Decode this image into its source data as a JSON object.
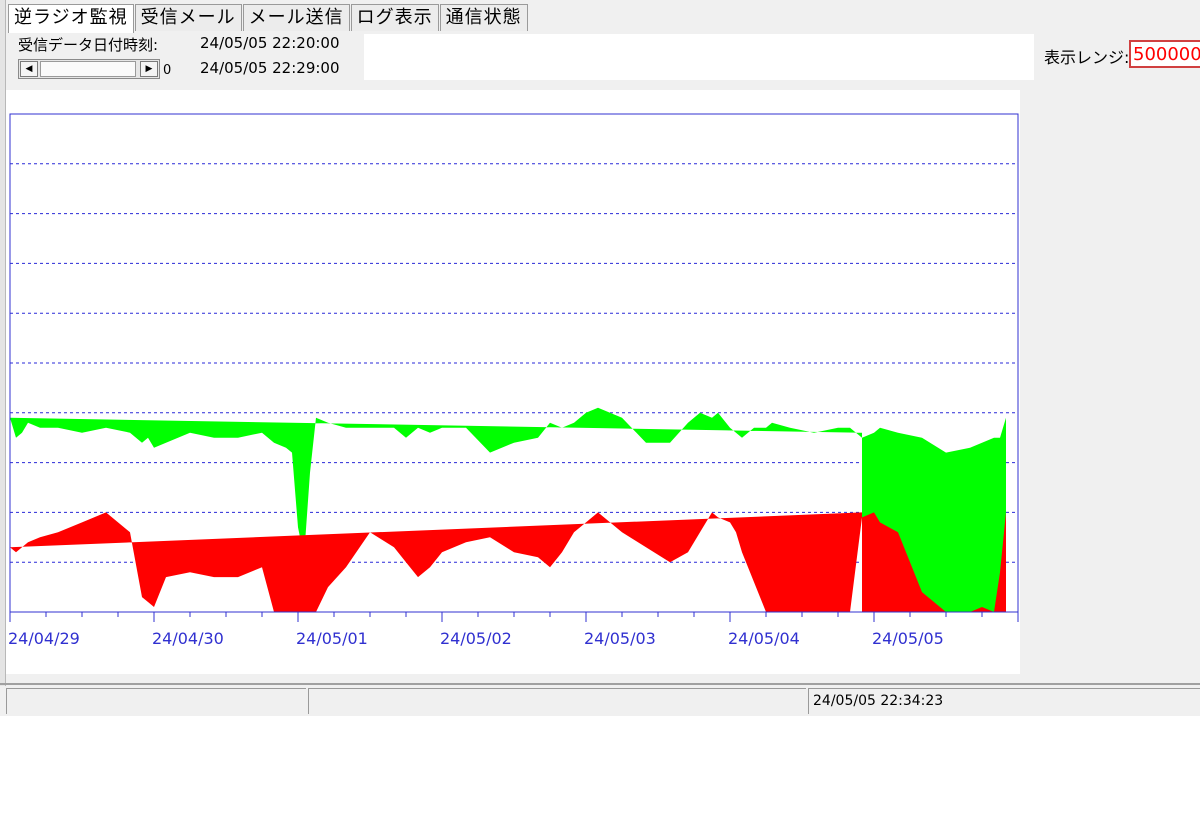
{
  "tabs": [
    {
      "label": "逆ラジオ監視",
      "active": true
    },
    {
      "label": "受信メール",
      "active": false
    },
    {
      "label": "メール送信",
      "active": false
    },
    {
      "label": "ログ表示",
      "active": false
    },
    {
      "label": "通信状態",
      "active": false
    }
  ],
  "header": {
    "recv_label": "受信データ日付時刻:",
    "recv_time_1": "24/05/05 22:20:00",
    "recv_time_2": "24/05/05 22:29:00",
    "scroll_value": "0",
    "range_label": "表示レンジ:",
    "range_value": "500000"
  },
  "colors": {
    "series_total": "#00ff00",
    "series_base": "#ff0000",
    "axis": "#3030d0",
    "grid": "#2a2ad8",
    "range_text": "#ff0000"
  },
  "chart_data": {
    "type": "area",
    "x": [
      "24/05/04 22:00",
      "24/04/29 00:00",
      "24/04/29 01:00",
      "24/04/29 02:00",
      "24/04/29 03:00",
      "24/04/29 05:00",
      "24/04/29 08:00",
      "24/04/29 12:00",
      "24/04/29 16:00",
      "24/04/29 20:00",
      "24/04/29 22:00",
      "24/04/29 23:00",
      "24/04/30 00:00",
      "24/04/30 02:00",
      "24/04/30 06:00",
      "24/04/30 10:00",
      "24/04/30 14:00",
      "24/04/30 18:00",
      "24/04/30 20:00",
      "24/04/30 22:00",
      "24/04/30 23:00",
      "24/05/01 00:00",
      "24/05/01 01:00",
      "24/05/01 02:00",
      "24/05/01 03:00",
      "24/05/01 05:00",
      "24/05/01 08:00",
      "24/05/01 12:00",
      "24/05/01 16:00",
      "24/05/01 18:00",
      "24/05/01 20:00",
      "24/05/01 22:00",
      "24/05/02 00:00",
      "24/05/02 04:00",
      "24/05/02 08:00",
      "24/05/02 12:00",
      "24/05/02 16:00",
      "24/05/02 18:00",
      "24/05/02 20:00",
      "24/05/02 22:00",
      "24/05/03 00:00",
      "24/05/03 02:00",
      "24/05/03 06:00",
      "24/05/03 10:00",
      "24/05/03 14:00",
      "24/05/03 17:00",
      "24/05/03 19:00",
      "24/05/03 21:00",
      "24/05/03 22:00",
      "24/05/04 00:00",
      "24/05/04 01:00",
      "24/05/04 02:00",
      "24/05/04 04:00",
      "24/05/04 06:00",
      "24/05/04 07:00",
      "24/05/04 10:00",
      "24/05/04 14:00",
      "24/05/04 18:00",
      "24/05/04 20:00",
      "24/05/04 22:00",
      "24/05/05 00:00",
      "24/05/05 01:00",
      "24/05/05 04:00",
      "24/05/05 08:00",
      "24/05/05 12:00",
      "24/05/05 16:00",
      "24/05/05 18:00",
      "24/05/05 20:00",
      "24/05/05 21:00",
      "24/05/05 22:00"
    ],
    "series": [
      {
        "values": [
          180000,
          195000,
          175000,
          180000,
          190000,
          185000,
          185000,
          180000,
          185000,
          180000,
          170000,
          175000,
          165000,
          170000,
          180000,
          175000,
          175000,
          180000,
          170000,
          165000,
          160000,
          85000,
          55000,
          140000,
          195000,
          190000,
          185000,
          185000,
          185000,
          175000,
          185000,
          180000,
          185000,
          185000,
          160000,
          170000,
          175000,
          190000,
          185000,
          190000,
          200000,
          205000,
          195000,
          170000,
          170000,
          190000,
          200000,
          195000,
          200000,
          185000,
          180000,
          175000,
          185000,
          185000,
          190000,
          185000,
          180000,
          185000,
          185000,
          175000,
          180000,
          185000,
          180000,
          175000,
          160000,
          165000,
          170000,
          175000,
          175000,
          195000
        ]
      },
      {
        "values": [
          100000,
          65000,
          60000,
          65000,
          70000,
          75000,
          80000,
          90000,
          100000,
          80000,
          15000,
          10000,
          5000,
          35000,
          40000,
          35000,
          35000,
          45000,
          0,
          0,
          0,
          0,
          0,
          0,
          0,
          25000,
          45000,
          80000,
          65000,
          50000,
          35000,
          45000,
          60000,
          70000,
          75000,
          60000,
          55000,
          45000,
          60000,
          80000,
          90000,
          100000,
          80000,
          65000,
          50000,
          60000,
          80000,
          100000,
          95000,
          90000,
          80000,
          60000,
          30000,
          0,
          0,
          0,
          0,
          0,
          0,
          95000,
          100000,
          90000,
          80000,
          20000,
          0,
          0,
          5000,
          0,
          40000,
          100000
        ]
      }
    ],
    "x_tick_labels": [
      "24/04/29",
      "24/04/30",
      "24/05/01",
      "24/05/02",
      "24/05/03",
      "24/05/04",
      "24/05/05"
    ],
    "ylim": [
      0,
      500000
    ],
    "gridlines": [
      50000,
      100000,
      150000,
      200000,
      250000,
      300000,
      350000,
      400000,
      450000
    ],
    "grid": true
  },
  "status": {
    "panel_1": "",
    "panel_2": "",
    "panel_3": "24/05/05 22:34:23"
  }
}
